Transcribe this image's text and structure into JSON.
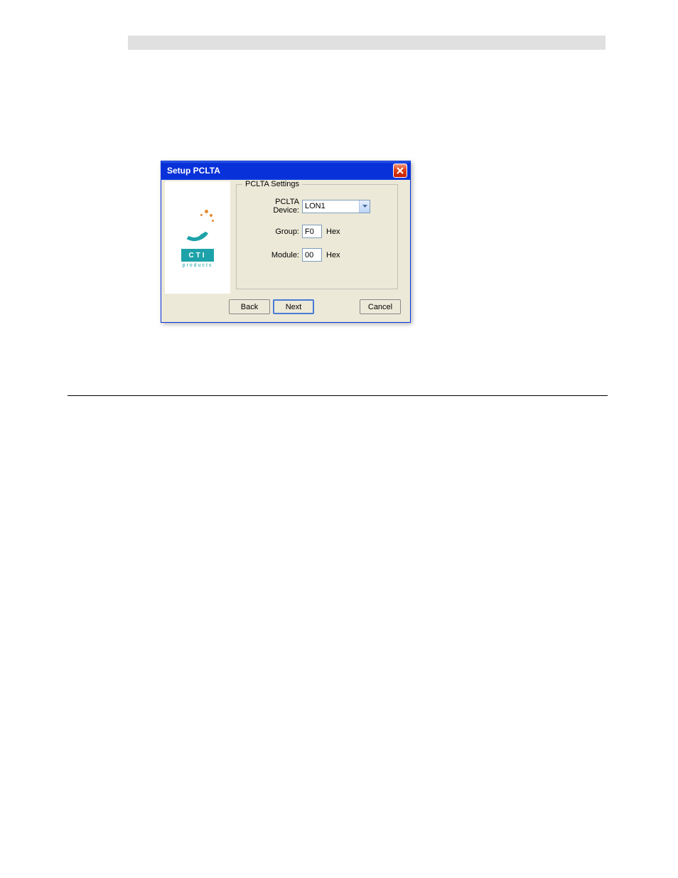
{
  "dialog": {
    "title": "Setup PCLTA",
    "groupbox_title": "PCLTA Settings",
    "fields": {
      "device": {
        "label": "PCLTA Device:",
        "value": "LON1"
      },
      "group": {
        "label": "Group:",
        "value": "F0",
        "suffix": "Hex"
      },
      "module": {
        "label": "Module:",
        "value": "00",
        "suffix": "Hex"
      }
    },
    "buttons": {
      "back": "Back",
      "next": "Next",
      "cancel": "Cancel"
    },
    "logo": {
      "brand": "CTI",
      "sub": "products"
    }
  }
}
